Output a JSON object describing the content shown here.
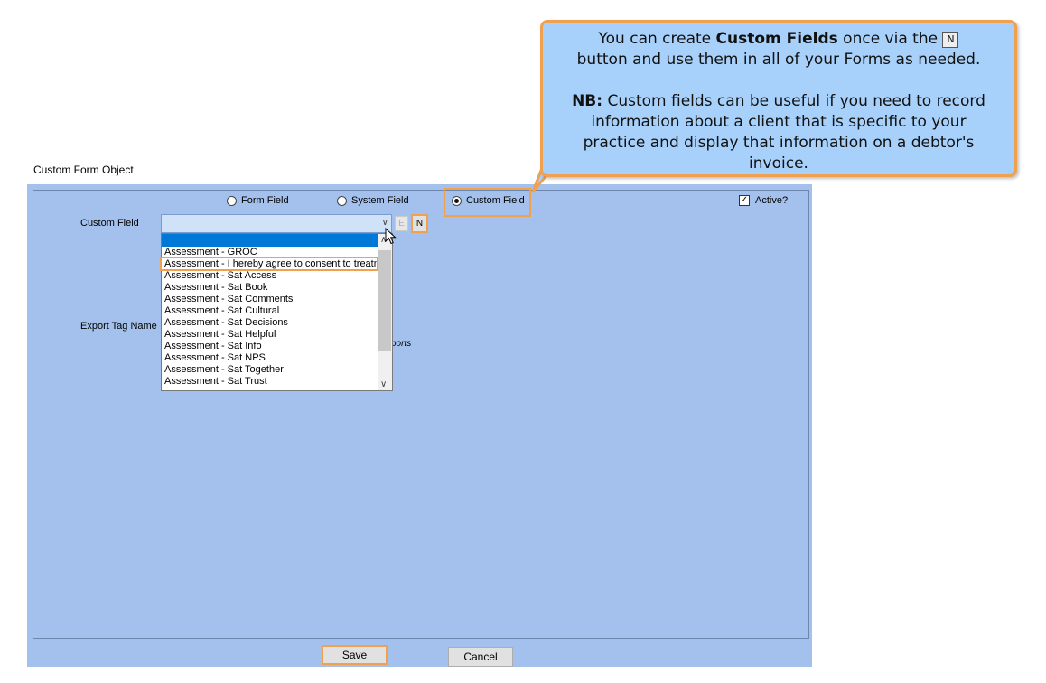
{
  "window": {
    "title": "Custom Form Object"
  },
  "field_type": {
    "form_field_label": "Form Field",
    "system_field_label": "System Field",
    "custom_field_label": "Custom Field",
    "selected": "Custom Field"
  },
  "active": {
    "label": "Active?",
    "checked": true
  },
  "custom_field": {
    "label": "Custom Field",
    "value": "",
    "edit_label": "E",
    "new_label": "N"
  },
  "dropdown": {
    "items": [
      "",
      "Assessment - GROC",
      "Assessment - I hereby agree to consent to treatme",
      "Assessment - Sat Access",
      "Assessment - Sat Book",
      "Assessment - Sat Comments",
      "Assessment - Sat Cultural",
      "Assessment - Sat Decisions",
      "Assessment - Sat Helpful",
      "Assessment - Sat Info",
      "Assessment - Sat NPS",
      "Assessment - Sat Together",
      "Assessment - Sat Trust"
    ]
  },
  "export_tag": {
    "label": "Export Tag Name",
    "hidden_text": "ports"
  },
  "buttons": {
    "save": "Save",
    "cancel": "Cancel"
  },
  "callout": {
    "line1_pre": "You can create ",
    "line1_bold": "Custom Fields",
    "line1_post": " once via the ",
    "key": "N",
    "line2": "button and use them in all of your Forms as needed.",
    "nb_label": "NB:",
    "nb_text": " Custom fields can be useful if you need to record information about a client that is specific to your practice and display that information on a debtor's invoice."
  },
  "colors": {
    "panel": "#a3c1ec",
    "highlight": "#f0a150",
    "callout": "#a7d1fb",
    "selection": "#0078d7"
  }
}
